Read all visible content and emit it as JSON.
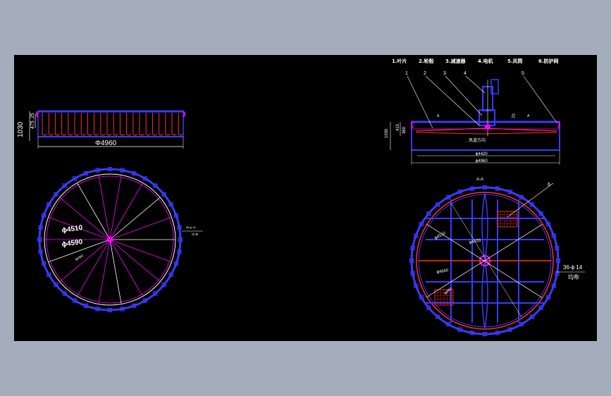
{
  "colors": {
    "background_outer": "#a4adbb",
    "canvas": "#000000",
    "outline": "#3a3aff",
    "blade": "#ff3030",
    "hub": "#ff00ff",
    "dimension": "#ffffff",
    "leader": "#ffffff"
  },
  "left_view": {
    "dim_height_total": "1030",
    "dim_height_part_a": "475",
    "dim_height_part_b": "25",
    "dim_diameter": "Φ4960",
    "dim_inner_1": "ϕ4510",
    "dim_inner_2": "ϕ4590",
    "dim_inner_3": "ϕ4Ф0",
    "side_note_1": "36-ϕ 14",
    "side_note_2": "均  布"
  },
  "right_view": {
    "legend": [
      "1.叶片",
      "2.轮毂",
      "3.减速器",
      "4.电机",
      "5.风筒",
      "6.防护网"
    ],
    "part_numbers": [
      "1",
      "2",
      "3",
      "4",
      "5",
      "6"
    ],
    "dim_height_total": "1030",
    "dim_height_a": "410",
    "dim_height_b": "360",
    "dim_top": "70",
    "dim_inner": "ϕ4420",
    "dim_outer": "ϕ4960",
    "flow_text": "风道方向",
    "top_mark": "A",
    "top_mark_2": "A",
    "section_mark": "A-A",
    "circle_dim_1": "ϕ4510",
    "circle_dim_2": "ϕ4640",
    "circle_dim_3": "ϕ4Ф0",
    "circle_dim_4": "ϕ4420",
    "bolt_note": "36-ϕ 14",
    "bolt_note_2": "均布"
  }
}
